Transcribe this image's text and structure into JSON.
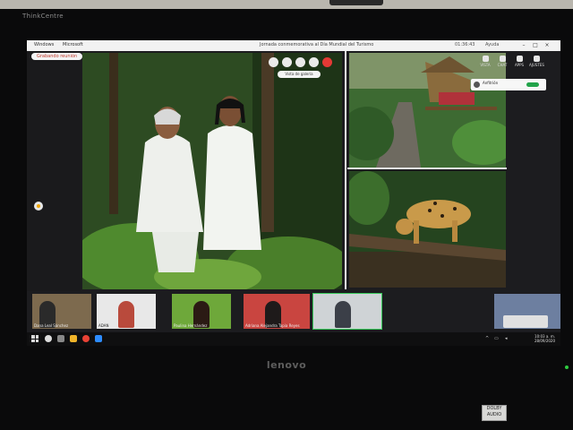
{
  "monitor": {
    "brand_top": "ThinkCentre",
    "brand_bottom": "lenovo",
    "sticker": "DOLBY AUDIO"
  },
  "window": {
    "tabs": [
      "Windows",
      "Microsoft"
    ],
    "title": "Jornada conmemorativa al Día Mundial del Turismo",
    "right_items": [
      "01:36:43",
      "Ayuda"
    ],
    "rec_badge": "Grabando reunión"
  },
  "stage": {
    "selector_label": "Vista de galería"
  },
  "toast": {
    "text": "Anfitrión"
  },
  "toolbar_right": [
    {
      "label": "VISTA",
      "icon": "view-icon"
    },
    {
      "label": "CHAT",
      "icon": "chat-icon"
    },
    {
      "label": "APPS",
      "icon": "apps-icon"
    },
    {
      "label": "AJUSTES",
      "icon": "gear-icon"
    }
  ],
  "participants": [
    {
      "name": "Dana Leal Sánchez"
    },
    {
      "name": "ADAN"
    },
    {
      "name": "Paulina Hernández"
    },
    {
      "name": "Adriana Alejandra Tapia Reyes"
    },
    {
      "name": ""
    }
  ],
  "taskbar": {
    "time": "10:03 a. m.",
    "date": "28/09/2020"
  },
  "colors": {
    "active_speaker_border": "#35c759",
    "record_dot": "#e53935",
    "desk": "#0a0a0b"
  }
}
